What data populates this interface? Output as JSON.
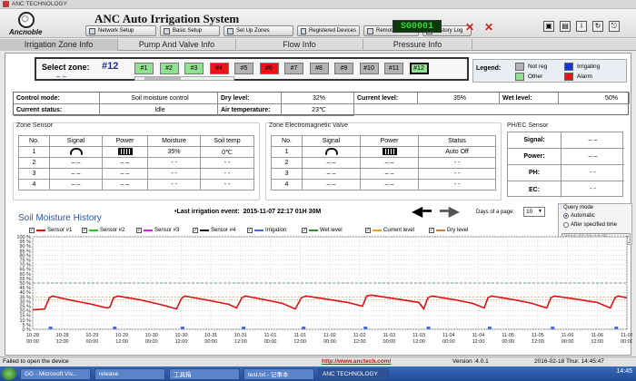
{
  "window": {
    "title": "ANC TECHNOLOGY"
  },
  "header": {
    "logo_text": "Ancnoble",
    "app_title": "ANC Auto Irrigation System",
    "device_id": "SG0001",
    "nav": [
      {
        "label": "Network Setup",
        "icon": "network-icon"
      },
      {
        "label": "Basic Setup",
        "icon": "gear-icon"
      },
      {
        "label": "Set Up Zones",
        "icon": "zones-icon"
      },
      {
        "label": "Registered Devices",
        "icon": "devices-icon"
      },
      {
        "label": "Remote Control",
        "icon": "remote-icon"
      },
      {
        "label": "History Log",
        "icon": "history-icon"
      }
    ],
    "tool_icons": [
      "screenshot-icon",
      "save-icon",
      "info-icon",
      "refresh-icon",
      "exit-icon"
    ]
  },
  "tabs": [
    "Irrigation Zone Info",
    "Pump And Valve Info",
    "Flow Info",
    "Pressure Info"
  ],
  "zone": {
    "label": "Select zone:",
    "value": "#12",
    "dashes": "– –",
    "buttons": [
      {
        "label": "#1",
        "state": "other"
      },
      {
        "label": "#2",
        "state": "other"
      },
      {
        "label": "#3",
        "state": "other"
      },
      {
        "label": "#4",
        "state": "alarm"
      },
      {
        "label": "#5",
        "state": "not_reg"
      },
      {
        "label": "#6",
        "state": "alarm"
      },
      {
        "label": "#7",
        "state": "not_reg"
      },
      {
        "label": "#8",
        "state": "not_reg"
      },
      {
        "label": "#9",
        "state": "not_reg"
      },
      {
        "label": "#10",
        "state": "not_reg"
      },
      {
        "label": "#11",
        "state": "not_reg"
      },
      {
        "label": "#12",
        "state": "selected"
      }
    ]
  },
  "legend": {
    "title": "Legend:",
    "items": [
      {
        "label": "Not reg",
        "color": "#b4b4b4"
      },
      {
        "label": "Irrigating",
        "color": "#1436d6"
      },
      {
        "label": "Other",
        "color": "#8fe28f"
      },
      {
        "label": "Alarm",
        "color": "#e81515"
      }
    ]
  },
  "status": {
    "control_mode_label": "Control mode:",
    "control_mode": "Soil moisture control",
    "dry_level_label": "Dry level:",
    "dry_level": "32%",
    "current_level_label": "Current level:",
    "current_level": "35%",
    "wet_level_label": "Wet level:",
    "wet_level": "50%",
    "current_status_label": "Current status:",
    "current_status": "Idle",
    "air_temp_label": "Air temperature:",
    "air_temp": "23℃"
  },
  "zone_sensor": {
    "title": "Zone Sensor",
    "headers": [
      "No.",
      "Signal",
      "Power",
      "Moisture",
      "Soil temp"
    ],
    "rows": [
      [
        "1",
        "",
        "",
        "35%",
        "0℃"
      ],
      [
        "2",
        "– –",
        "– –",
        "- -",
        "- -"
      ],
      [
        "3",
        "– –",
        "– –",
        "- -",
        "- -"
      ],
      [
        "4",
        "– –",
        "– –",
        "- -",
        "- -"
      ]
    ]
  },
  "valve": {
    "title": "Zone Electromagnetic Valve",
    "headers": [
      "No.",
      "Signal",
      "Power",
      "Status"
    ],
    "rows": [
      [
        "1",
        "",
        "",
        "Auto Off"
      ],
      [
        "2",
        "– –",
        "– –",
        "- -"
      ],
      [
        "3",
        "– –",
        "– –",
        "- -"
      ],
      [
        "4",
        "– –",
        "– –",
        "- -"
      ]
    ]
  },
  "phec": {
    "title": "PH/EC Sensor",
    "rows": [
      {
        "label": "Signal:",
        "value": "– –"
      },
      {
        "label": "Power:",
        "value": "– –"
      },
      {
        "label": "PH:",
        "value": "- -"
      },
      {
        "label": "EC:",
        "value": "- -"
      }
    ]
  },
  "last_event": {
    "label": "•Last irrigation event:",
    "value": "2015-11-07 22:17   01H 30M"
  },
  "days_page": {
    "label": "Days of a page:",
    "value": "10"
  },
  "query": {
    "title": "Query mode",
    "options": [
      "Automatic",
      "After specified time"
    ],
    "selected": "Automatic",
    "datetime": "2016-02-18 14:45"
  },
  "chart_data": {
    "type": "line",
    "title": "Soil Moisture History",
    "xlabel": "",
    "ylabel": "",
    "ylim": [
      0,
      100
    ],
    "yticks": [
      "100 %",
      "95 %",
      "90 %",
      "85 %",
      "80 %",
      "75 %",
      "70 %",
      "65 %",
      "60 %",
      "55 %",
      "50 %",
      "45 %",
      "40 %",
      "35 %",
      "30 %",
      "25 %",
      "20 %",
      "15 %",
      "10 %",
      "5 %",
      "0 %"
    ],
    "xlim": [
      0,
      10
    ],
    "xticks": [
      {
        "x": 0.0,
        "l1": "10-28",
        "l2": "00:00"
      },
      {
        "x": 0.5,
        "l1": "10-28",
        "l2": "12:00"
      },
      {
        "x": 1.0,
        "l1": "10-29",
        "l2": "00:00"
      },
      {
        "x": 1.5,
        "l1": "10-29",
        "l2": "12:00"
      },
      {
        "x": 2.0,
        "l1": "10-30",
        "l2": "00:00"
      },
      {
        "x": 2.5,
        "l1": "10-30",
        "l2": "12:00"
      },
      {
        "x": 3.0,
        "l1": "10-31",
        "l2": "00:00"
      },
      {
        "x": 3.5,
        "l1": "10-31",
        "l2": "12:00"
      },
      {
        "x": 4.0,
        "l1": "11-01",
        "l2": "00:00"
      },
      {
        "x": 4.5,
        "l1": "11-01",
        "l2": "12:00"
      },
      {
        "x": 5.0,
        "l1": "11-02",
        "l2": "00:00"
      },
      {
        "x": 5.5,
        "l1": "11-02",
        "l2": "12:00"
      },
      {
        "x": 6.0,
        "l1": "11-03",
        "l2": "00:00"
      },
      {
        "x": 6.5,
        "l1": "11-03",
        "l2": "12:00"
      },
      {
        "x": 7.0,
        "l1": "11-04",
        "l2": "00:00"
      },
      {
        "x": 7.5,
        "l1": "11-04",
        "l2": "12:00"
      },
      {
        "x": 8.0,
        "l1": "11-05",
        "l2": "00:00"
      },
      {
        "x": 8.5,
        "l1": "11-05",
        "l2": "12:00"
      },
      {
        "x": 9.0,
        "l1": "11-06",
        "l2": "00:00"
      },
      {
        "x": 9.5,
        "l1": "11-06",
        "l2": "12:00"
      },
      {
        "x": 10.0,
        "l1": "11-07",
        "l2": "00:00"
      }
    ],
    "legend": [
      {
        "name": "Sensor #1",
        "color": "#e01010",
        "checked": true
      },
      {
        "name": "Sensor #2",
        "color": "#28c828",
        "checked": true
      },
      {
        "name": "Sensor #3",
        "color": "#d028d0",
        "checked": true
      },
      {
        "name": "Sensor #4",
        "color": "#111111",
        "checked": true
      },
      {
        "name": "Irrigation",
        "color": "#4a6ad8",
        "checked": true
      },
      {
        "name": "Wet level",
        "color": "#2e8b2e",
        "checked": true
      },
      {
        "name": "Current level",
        "color": "#e8a030",
        "checked": true
      },
      {
        "name": "Dry level",
        "color": "#c88040",
        "checked": true
      }
    ],
    "wet_level": 50,
    "current_level": 35,
    "dry_level": 32,
    "series": [
      {
        "name": "Sensor #1",
        "color": "#e01010",
        "points": [
          [
            0.0,
            21
          ],
          [
            0.2,
            22
          ],
          [
            0.28,
            34
          ],
          [
            0.33,
            36
          ],
          [
            0.6,
            32
          ],
          [
            1.0,
            27
          ],
          [
            1.25,
            23
          ],
          [
            1.3,
            24
          ],
          [
            1.36,
            34
          ],
          [
            1.43,
            36
          ],
          [
            1.8,
            32
          ],
          [
            2.2,
            26
          ],
          [
            2.42,
            22
          ],
          [
            2.5,
            33
          ],
          [
            2.56,
            36
          ],
          [
            2.9,
            32
          ],
          [
            3.3,
            27
          ],
          [
            3.43,
            23
          ],
          [
            3.52,
            34
          ],
          [
            3.58,
            36
          ],
          [
            3.9,
            32
          ],
          [
            4.2,
            28
          ],
          [
            4.42,
            22
          ],
          [
            4.52,
            34
          ],
          [
            4.6,
            36
          ],
          [
            4.9,
            33
          ],
          [
            5.3,
            29
          ],
          [
            5.55,
            25
          ],
          [
            5.62,
            36
          ],
          [
            5.7,
            37
          ],
          [
            6.1,
            33
          ],
          [
            6.5,
            29
          ],
          [
            6.58,
            22
          ],
          [
            6.65,
            34
          ],
          [
            6.72,
            36
          ],
          [
            7.1,
            32
          ],
          [
            7.4,
            28
          ],
          [
            7.6,
            23
          ],
          [
            7.66,
            34
          ],
          [
            7.72,
            36
          ],
          [
            8.1,
            32
          ],
          [
            8.4,
            28
          ],
          [
            8.65,
            23
          ],
          [
            8.72,
            34
          ],
          [
            8.78,
            36
          ],
          [
            9.1,
            33
          ],
          [
            9.5,
            29
          ],
          [
            9.72,
            23
          ],
          [
            9.8,
            34
          ],
          [
            9.85,
            36
          ],
          [
            10.0,
            34
          ]
        ]
      }
    ],
    "irrigation_events": [
      0.3,
      1.38,
      2.52,
      3.55,
      4.56,
      5.6,
      6.66,
      7.69,
      8.75,
      9.82
    ]
  },
  "statusbar": {
    "message": "Failed to open the device",
    "url": "http://www.anctech.com/",
    "version": "Version :4.0.1",
    "date": "2016-02-18  Thur.  14:45:47"
  },
  "taskbar": {
    "items": [
      "GG - Microsoft Vis...",
      "release",
      "工具箱",
      "test.txt - 记事本",
      "ANC TECHNOLOGY"
    ],
    "clock": "14:45"
  }
}
